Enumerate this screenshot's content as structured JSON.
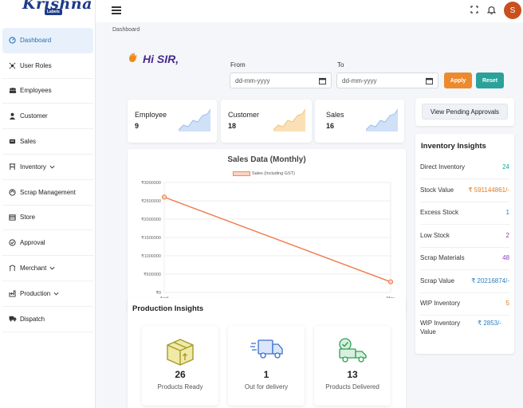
{
  "brand": {
    "name": "Krishna",
    "sub": "Labels"
  },
  "user": {
    "initial": "S"
  },
  "sidebar": {
    "items": [
      {
        "label": "Dashboard",
        "icon": "dashboard-icon"
      },
      {
        "label": "User Roles",
        "icon": "user-roles-icon"
      },
      {
        "label": "Employees",
        "icon": "employees-icon"
      },
      {
        "label": "Customer",
        "icon": "customer-icon"
      },
      {
        "label": "Sales",
        "icon": "sales-icon"
      },
      {
        "label": "Inventory",
        "icon": "inventory-icon"
      },
      {
        "label": "Scrap Management",
        "icon": "scrap-icon"
      },
      {
        "label": "Store",
        "icon": "store-icon"
      },
      {
        "label": "Approval",
        "icon": "approval-icon"
      },
      {
        "label": "Merchant",
        "icon": "merchant-icon"
      },
      {
        "label": "Production",
        "icon": "production-icon"
      },
      {
        "label": "Dispatch",
        "icon": "dispatch-icon"
      }
    ]
  },
  "breadcrumb": "Dashboard",
  "greeting": "Hi SIR,",
  "filters": {
    "from_label": "From",
    "to_label": "To",
    "from_placeholder": "dd-mm-yyyy",
    "to_placeholder": "dd-mm-yyyy",
    "apply": "Apply",
    "reset": "Reset"
  },
  "stats": [
    {
      "title": "Employee",
      "value": "9"
    },
    {
      "title": "Customer",
      "value": "18"
    },
    {
      "title": "Sales",
      "value": "16"
    }
  ],
  "pending_button": "View Pending Approvals",
  "inventory": {
    "title": "Inventory Insights",
    "rows": [
      {
        "label": "Direct Inventory",
        "value": "24",
        "color": "#1aa39b"
      },
      {
        "label": "Stock Value",
        "value": "₹ 591144861/-",
        "color": "#e07b1a"
      },
      {
        "label": "Excess Stock",
        "value": "1",
        "color": "#2a7fc0"
      },
      {
        "label": "Low Stock",
        "value": "2",
        "color": "#8a3fb5"
      },
      {
        "label": "Scrap Materials",
        "value": "48",
        "color": "#8a3fb5"
      },
      {
        "label": "Scrap Value",
        "value": "₹ 20216874/-",
        "color": "#2a7fc0"
      },
      {
        "label": "WIP Inventory",
        "value": "5",
        "color": "#e07b1a"
      },
      {
        "label": "WIP Inventory Value",
        "value": "₹ 2853/-",
        "color": "#2a7fc0"
      }
    ]
  },
  "chart_data": {
    "type": "line",
    "title": "Sales Data (Monthly)",
    "x": [
      "April",
      "May"
    ],
    "series": [
      {
        "name": "Sales (Including GST)",
        "values": [
          2600000,
          290000
        ],
        "color": "#f07a4a"
      }
    ],
    "y_ticks": [
      "₹0",
      "₹500000",
      "₹1000000",
      "₹1500000",
      "₹2000000",
      "₹2500000",
      "₹3000000"
    ],
    "ylim": [
      0,
      3000000
    ],
    "grid": true,
    "legend": "top"
  },
  "production": {
    "title": "Production Insights",
    "cards": [
      {
        "value": "26",
        "caption": "Products Ready",
        "icon": "box-icon"
      },
      {
        "value": "1",
        "caption": "Out for delivery",
        "icon": "delivery-truck-icon"
      },
      {
        "value": "13",
        "caption": "Products Delivered",
        "icon": "delivered-truck-icon"
      }
    ]
  }
}
